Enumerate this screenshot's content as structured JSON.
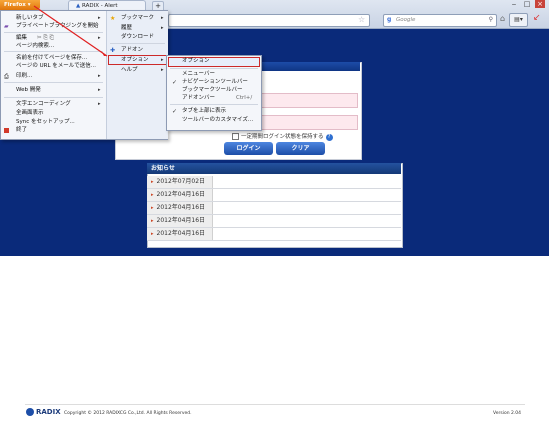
{
  "browser": {
    "firefox_button": "Firefox",
    "tab_title": "RADIX - Alert",
    "new_tab": "+",
    "search_placeholder": "Google",
    "search_engine_glyph": "g",
    "window_controls": [
      "‒",
      "□",
      "×"
    ]
  },
  "menu": {
    "left": [
      {
        "label": "新しいタブ",
        "arrow": true
      },
      {
        "label": "プライベートブラウジングを開始"
      },
      {
        "label": "編集"
      },
      {
        "label": "ページ内検索..."
      },
      {
        "label": "名前を付けてページを保存..."
      },
      {
        "label": "ページの URL をメールで送信..."
      },
      {
        "label": "印刷...",
        "arrow": true
      },
      {
        "label": "Web 開発",
        "arrow": true
      },
      {
        "label": "文字エンコーディング",
        "arrow": true
      },
      {
        "label": "全画面表示"
      },
      {
        "label": "Sync をセットアップ..."
      },
      {
        "label": "終了"
      }
    ],
    "right": [
      {
        "label": "ブックマーク",
        "arrow": true
      },
      {
        "label": "履歴",
        "arrow": true
      },
      {
        "label": "ダウンロード"
      },
      {
        "label": "アドオン"
      },
      {
        "label": "オプション",
        "arrow": true
      },
      {
        "label": "ヘルプ",
        "arrow": true
      }
    ]
  },
  "submenu": {
    "items": [
      {
        "label": "オプション"
      },
      {
        "label": "メニューバー"
      },
      {
        "label": "ナビゲーションツールバー",
        "checked": true
      },
      {
        "label": "ブックマークツールバー"
      },
      {
        "label": "アドオンバー",
        "shortcut": "Ctrl+/"
      },
      {
        "label": "タブを上部に表示",
        "checked": true
      },
      {
        "label": "ツールバーのカスタマイズ..."
      }
    ]
  },
  "login": {
    "remember_label": "一定期間ログイン状態を保持する",
    "login_button": "ログイン",
    "clear_button": "クリア"
  },
  "news": {
    "title": "お知らせ",
    "rows": [
      {
        "date": "2012年07月02日"
      },
      {
        "date": "2012年04月16日"
      },
      {
        "date": "2012年04月16日"
      },
      {
        "date": "2012年04月16日"
      },
      {
        "date": "2012年04月16日"
      }
    ]
  },
  "footer": {
    "logo": "RADIX",
    "copyright": "Copyright © 2012 RADIXCG Co.,Ltd. All Rights Reserved.",
    "version": "Version 2.04"
  }
}
